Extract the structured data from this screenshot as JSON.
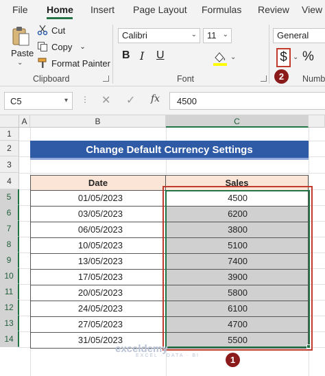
{
  "menu": {
    "tabs": [
      "File",
      "Home",
      "Insert",
      "Page Layout",
      "Formulas",
      "Review",
      "View"
    ]
  },
  "ribbon": {
    "clipboard": {
      "paste_label": "Paste",
      "cut_label": "Cut",
      "copy_label": "Copy",
      "format_painter_label": "Format Painter",
      "group_label": "Clipboard"
    },
    "font": {
      "font_name": "Calibri",
      "font_size": "11",
      "bold": "B",
      "italic": "I",
      "underline": "U",
      "group_label": "Font"
    },
    "number": {
      "format": "General",
      "currency_symbol": "$",
      "percent_symbol": "%",
      "group_label": "Numb"
    }
  },
  "formula_bar": {
    "name_box": "C5",
    "fx": "fx",
    "value": "4500"
  },
  "sheet": {
    "columns": [
      "A",
      "B",
      "C"
    ],
    "rows": [
      "1",
      "2",
      "3",
      "4",
      "5",
      "6",
      "7",
      "8",
      "9",
      "10",
      "11",
      "12",
      "13",
      "14"
    ],
    "title": "Change Default Currency Settings",
    "headers": {
      "date": "Date",
      "sales": "Sales"
    },
    "records": [
      {
        "date": "01/05/2023",
        "sales": "4500"
      },
      {
        "date": "03/05/2023",
        "sales": "6200"
      },
      {
        "date": "06/05/2023",
        "sales": "3800"
      },
      {
        "date": "10/05/2023",
        "sales": "5100"
      },
      {
        "date": "13/05/2023",
        "sales": "7400"
      },
      {
        "date": "17/05/2023",
        "sales": "3900"
      },
      {
        "date": "20/05/2023",
        "sales": "5800"
      },
      {
        "date": "24/05/2023",
        "sales": "6100"
      },
      {
        "date": "27/05/2023",
        "sales": "4700"
      },
      {
        "date": "31/05/2023",
        "sales": "5500"
      }
    ]
  },
  "annotations": {
    "step1": "1",
    "step2": "2"
  },
  "watermark": {
    "brand": "exceldemy",
    "tagline": "EXCEL · DATA · BI"
  },
  "colors": {
    "title_fill": "#2e5aa6",
    "header_fill": "#fbe5d6",
    "selection_fill": "#d0d0d0",
    "excel_green": "#217346",
    "highlight_red": "#c0392b",
    "badge": "#8b1a1a"
  }
}
